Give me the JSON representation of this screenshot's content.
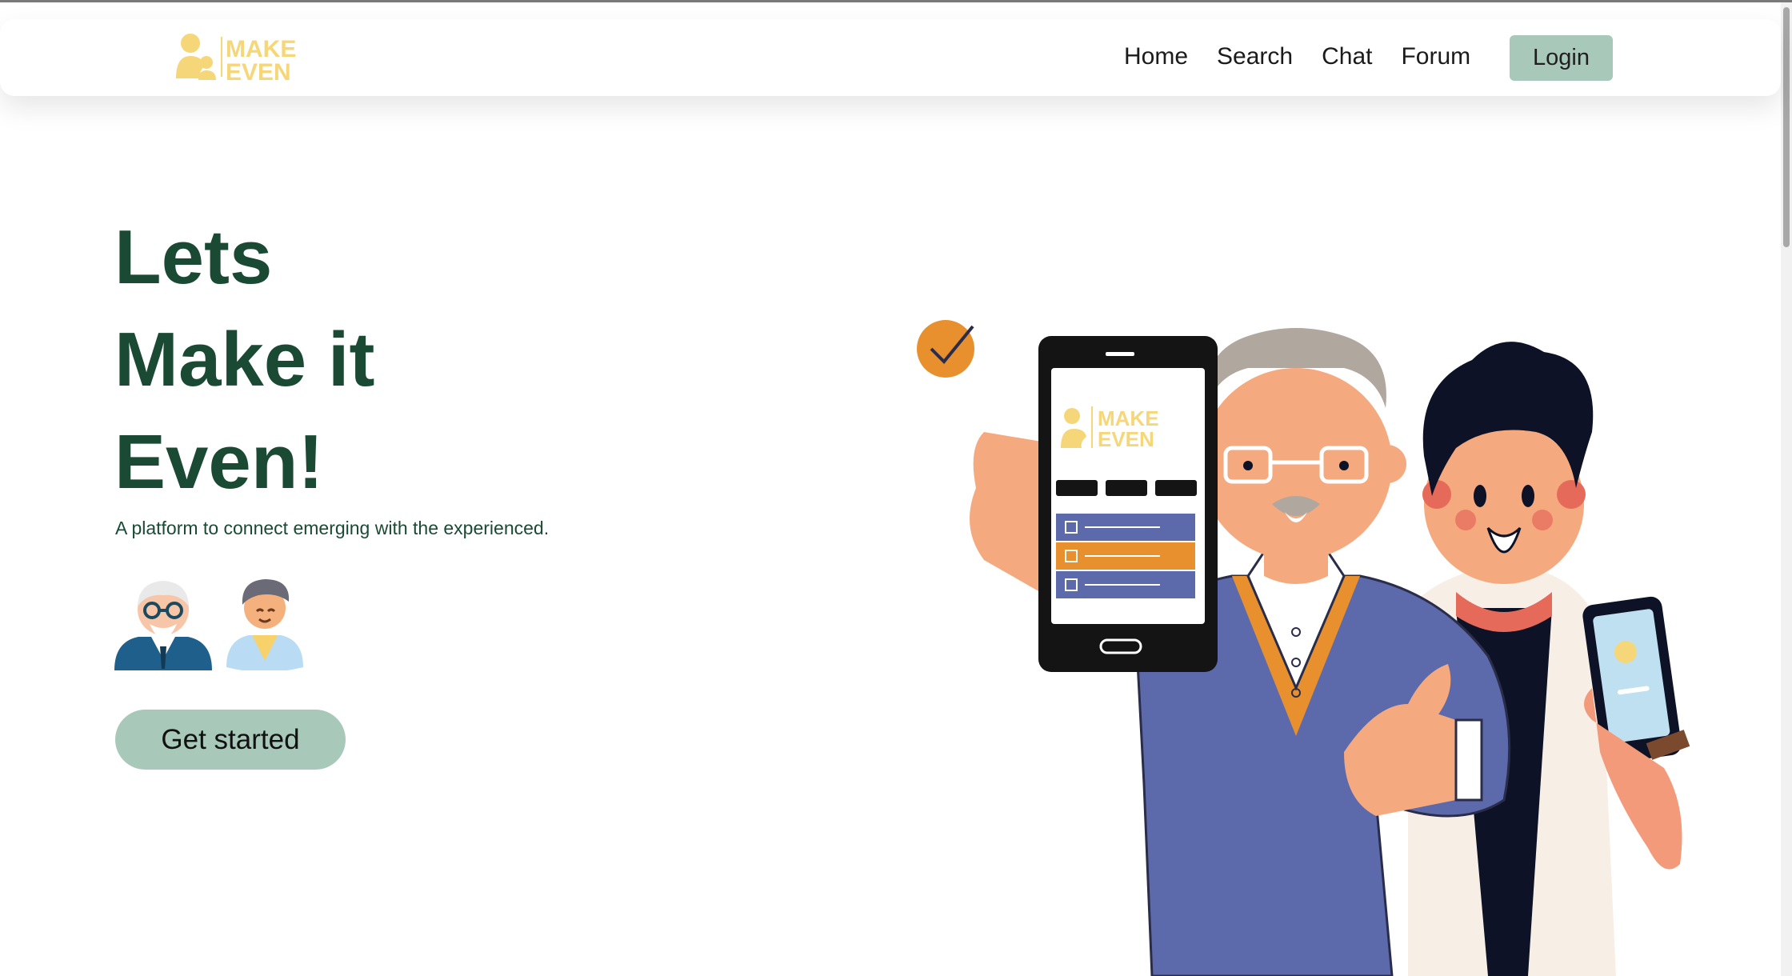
{
  "brand": {
    "logo_line1": "MAKE",
    "logo_line2": "EVEN",
    "logo_color": "#f5d77a"
  },
  "nav": {
    "items": [
      {
        "label": "Home"
      },
      {
        "label": "Search"
      },
      {
        "label": "Chat"
      },
      {
        "label": "Forum"
      }
    ],
    "login_label": "Login"
  },
  "hero": {
    "title_lines": [
      "Lets",
      "Make it",
      "Even!"
    ],
    "subtitle": "A platform to connect emerging with the experienced.",
    "cta_label": "Get started",
    "avatars": [
      "elderly-man-avatar-icon",
      "young-man-avatar-icon"
    ]
  },
  "illustration": {
    "phone_logo_line1": "MAKE",
    "phone_logo_line2": "EVEN",
    "description_icon": "elderly-and-young-man-with-phones-illustration"
  },
  "colors": {
    "accent": "#a8c9b9",
    "title": "#1b4a34",
    "brand_yellow": "#f5d77a",
    "sweater": "#5c6aab",
    "orange": "#e8902e"
  }
}
